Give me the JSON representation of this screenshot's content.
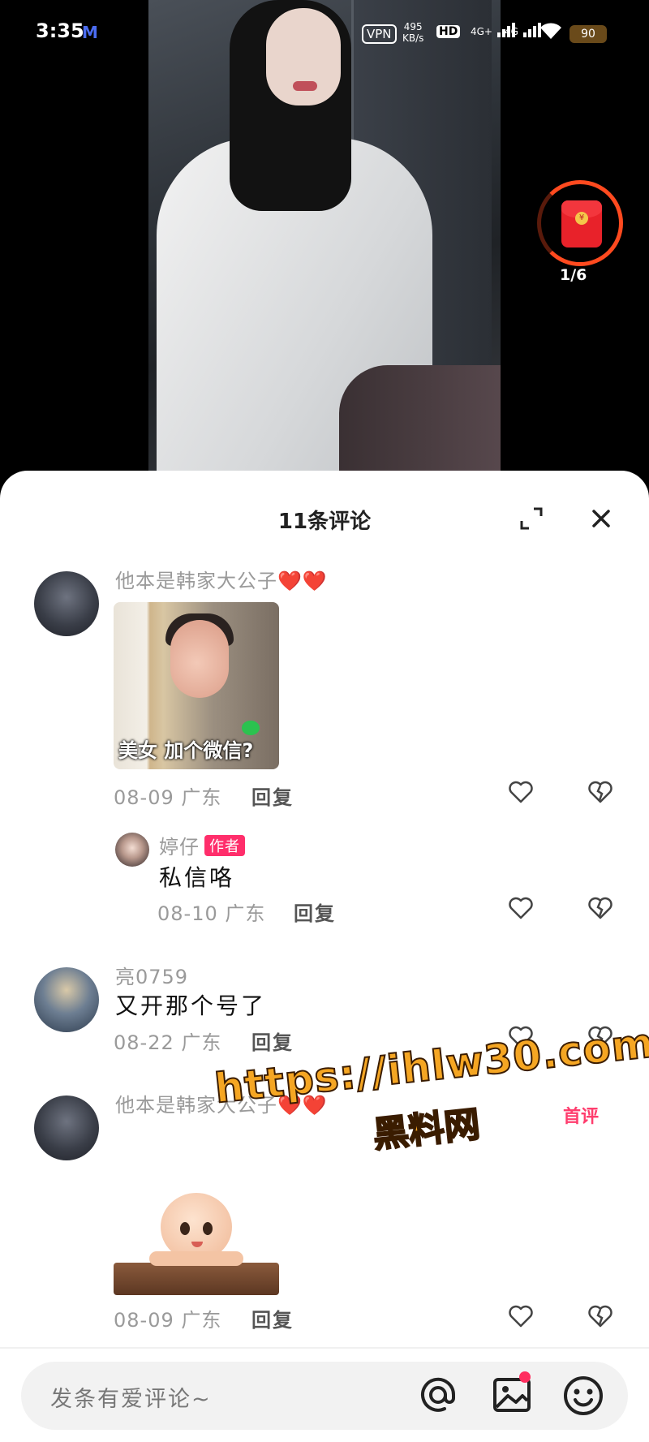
{
  "status_bar": {
    "time": "3:35",
    "app_icon": "M",
    "vpn": "VPN",
    "net_speed_value": "495",
    "net_speed_unit": "KB/s",
    "hd": "HD",
    "signal1": "4G+",
    "signal2": "4G",
    "battery": "90"
  },
  "red_packet": {
    "counter": "1/6",
    "coin": "¥"
  },
  "sheet": {
    "title": "11条评论"
  },
  "comments": [
    {
      "username": "他本是韩家大公子",
      "hearts": "❤️❤️",
      "sticker_caption": "美女 加个微信?",
      "date": "08-09",
      "location": "广东",
      "reply_label": "回复",
      "replies": [
        {
          "username": "婷仔",
          "badge": "作者",
          "text": "私信咯",
          "date": "08-10",
          "location": "广东",
          "reply_label": "回复"
        }
      ]
    },
    {
      "username": "亮0759",
      "text": "又开那个号了",
      "date": "08-22",
      "location": "广东",
      "reply_label": "回复"
    },
    {
      "username": "他本是韩家大公子",
      "hearts": "❤️❤️",
      "first_badge": "首评",
      "date": "08-09",
      "location": "广东",
      "reply_label": "回复"
    }
  ],
  "watermark": {
    "url": "https://ihlw30.com",
    "site": "黑料网"
  },
  "input": {
    "placeholder": "发条有爱评论~"
  },
  "colors": {
    "accent": "#ff2e6b",
    "red_packet": "#e8222a",
    "watermark": "#f5a623"
  }
}
